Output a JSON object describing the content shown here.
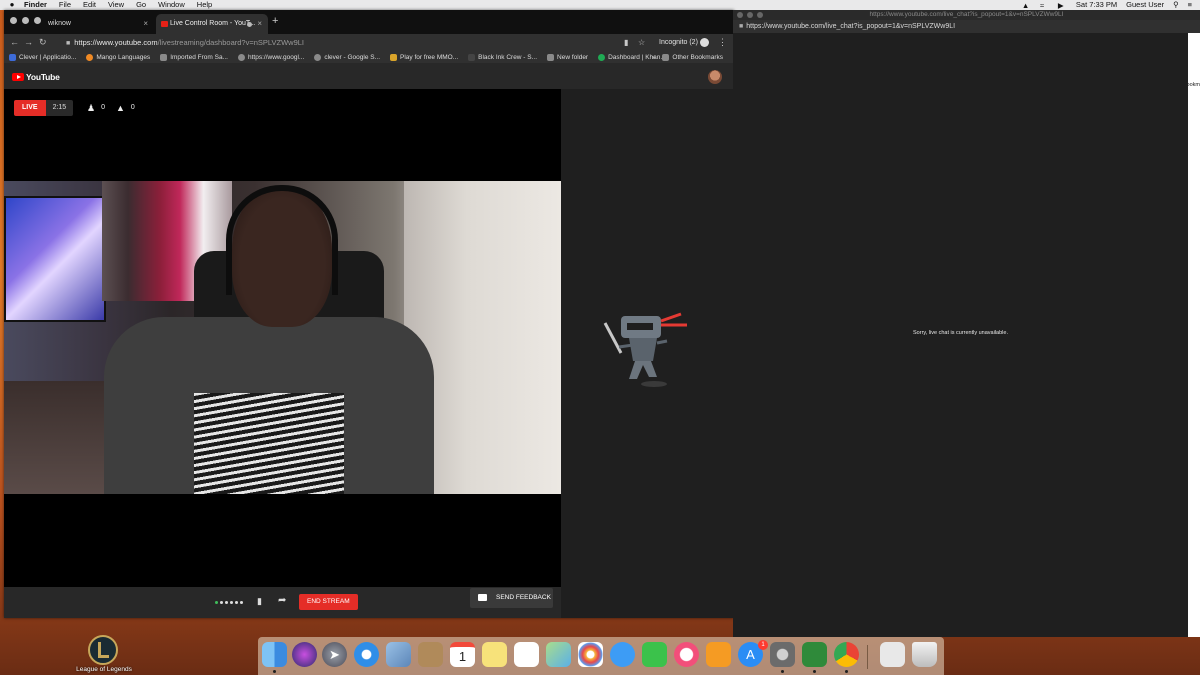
{
  "menubar": {
    "app": "Finder",
    "items": [
      "File",
      "Edit",
      "View",
      "Go",
      "Window",
      "Help"
    ],
    "clock": "Sat 7:33 PM",
    "user": "Guest User"
  },
  "chrome": {
    "tabs": [
      {
        "title": "wiknow"
      },
      {
        "title": "Live Control Room - YouT..."
      }
    ],
    "url_host": "https://www.youtube.com",
    "url_path": "/livestreaming/dashboard?v=nSPLVZWw9LI",
    "incognito": "Incognito (2)",
    "bookmarks": [
      {
        "label": "Clever | Applicatio...",
        "color": "#3d6bd8"
      },
      {
        "label": "Mango Languages",
        "color": "#f08a24"
      },
      {
        "label": "Imported From Sa...",
        "color": "#8a8a8a"
      },
      {
        "label": "https://www.googl...",
        "color": "#8a8a8a"
      },
      {
        "label": "clever - Google S...",
        "color": "#8a8a8a"
      },
      {
        "label": "Play for free MMO...",
        "color": "#d9a42a"
      },
      {
        "label": "Black Ink Crew - S...",
        "color": "#444444"
      },
      {
        "label": "New folder",
        "color": "#8a8a8a"
      },
      {
        "label": "Dashboard | Khan...",
        "color": "#1fab54"
      }
    ],
    "other_bookmarks": "Other Bookmarks"
  },
  "youtube": {
    "logo": "YouTube",
    "live_label": "LIVE",
    "elapsed": "2:15",
    "viewers": "0",
    "likes": "0",
    "end_stream": "END STREAM",
    "send_feedback": "SEND FEEDBACK"
  },
  "popup": {
    "title_url": "https://www.youtube.com/live_chat?is_popout=1&v=nSPLVZWw9LI",
    "url": "https://www.youtube.com/live_chat?is_popout=1&v=nSPLVZWw9LI",
    "message": "Sorry, live chat is currently unavailable.",
    "edge_text": "ookm"
  },
  "desktop": {
    "icon_label": "League of Legends"
  },
  "dock": {
    "calendar_day": "1",
    "appstore_badge": "1",
    "apps": [
      {
        "name": "finder",
        "color": "#3b8be0"
      },
      {
        "name": "siri",
        "color": "#2b2b6b"
      },
      {
        "name": "launchpad",
        "color": "#6a6a7a"
      },
      {
        "name": "safari",
        "color": "#2f8ee8"
      },
      {
        "name": "preview",
        "color": "#5c86b8"
      },
      {
        "name": "contacts",
        "color": "#b08a5a"
      },
      {
        "name": "calendar",
        "color": "#ffffff"
      },
      {
        "name": "notes",
        "color": "#f7e27a"
      },
      {
        "name": "reminders",
        "color": "#ffffff"
      },
      {
        "name": "maps",
        "color": "#7cc16a"
      },
      {
        "name": "photos",
        "color": "#ffffff"
      },
      {
        "name": "messages",
        "color": "#3d9cf5"
      },
      {
        "name": "facetime",
        "color": "#3bc24b"
      },
      {
        "name": "itunes",
        "color": "#f24f7a"
      },
      {
        "name": "ibooks",
        "color": "#f59b23"
      },
      {
        "name": "app-store",
        "color": "#2a8df5"
      },
      {
        "name": "system-preferences",
        "color": "#8b8b8b"
      },
      {
        "name": "shield-app",
        "color": "#2f8a3a"
      },
      {
        "name": "chrome",
        "color": "#ffffff"
      },
      {
        "name": "downloads",
        "color": "#e8e8e8"
      },
      {
        "name": "trash",
        "color": "#dcdcdc"
      }
    ]
  }
}
